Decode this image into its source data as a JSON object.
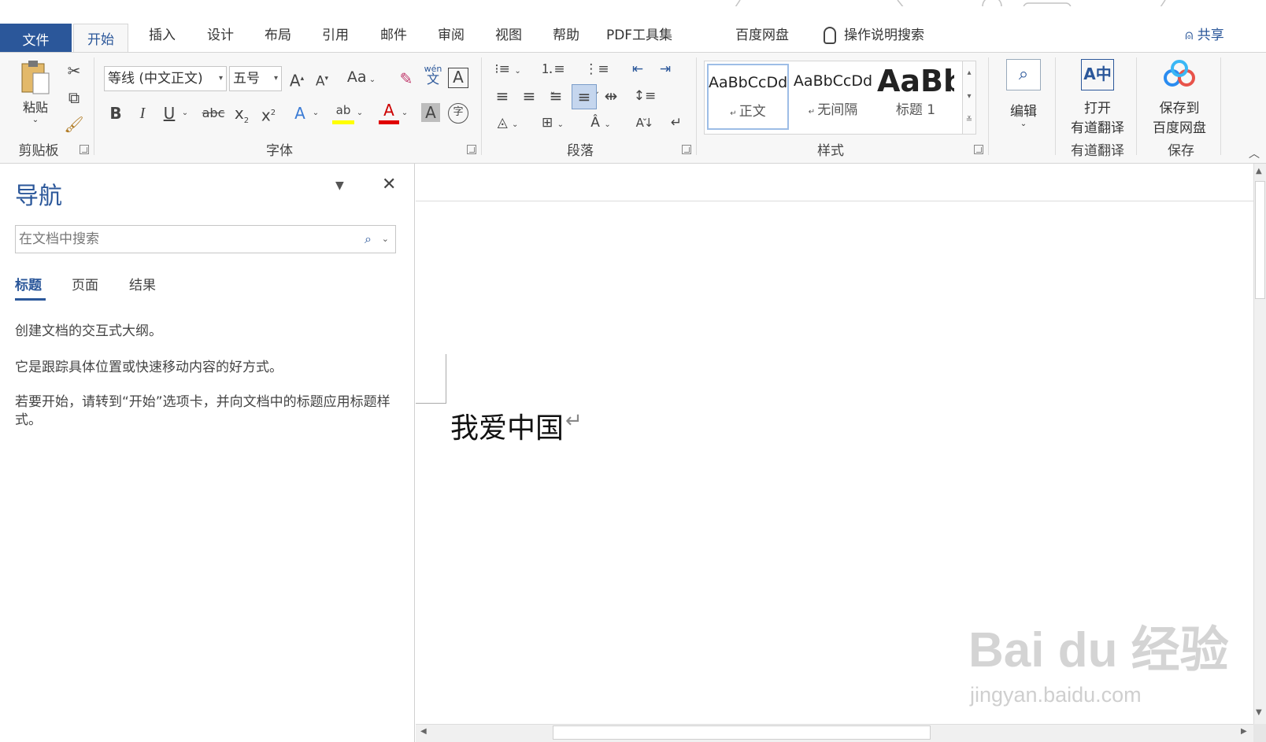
{
  "tabs": [
    {
      "label": "文件"
    },
    {
      "label": "开始"
    },
    {
      "label": "插入"
    },
    {
      "label": "设计"
    },
    {
      "label": "布局"
    },
    {
      "label": "引用"
    },
    {
      "label": "邮件"
    },
    {
      "label": "审阅"
    },
    {
      "label": "视图"
    },
    {
      "label": "帮助"
    },
    {
      "label": "PDF工具集"
    },
    {
      "label": "百度网盘"
    }
  ],
  "tell_me": "操作说明搜索",
  "share": "共享",
  "ribbon": {
    "clipboard": {
      "paste": "粘贴",
      "label": "剪贴板"
    },
    "font": {
      "name": "等线 (中文正文)",
      "size": "五号",
      "change_case": "Aa",
      "phonetic": "wén",
      "phonetic_char": "文",
      "label": "字体"
    },
    "paragraph": {
      "label": "段落"
    },
    "styles": {
      "label": "样式",
      "items": [
        {
          "sample": "AaBbCcDd",
          "name": "正文"
        },
        {
          "sample": "AaBbCcDd",
          "name": "无间隔"
        },
        {
          "sample": "AaBb",
          "name": "标题 1"
        }
      ]
    },
    "editing": {
      "label": "编辑"
    },
    "youdao": {
      "line1": "打开",
      "line2": "有道翻译",
      "label": "有道翻译"
    },
    "baidu": {
      "line1": "保存到",
      "line2": "百度网盘",
      "label": "保存"
    }
  },
  "nav": {
    "title": "导航",
    "search_placeholder": "在文档中搜索",
    "tabs": [
      {
        "label": "标题"
      },
      {
        "label": "页面"
      },
      {
        "label": "结果"
      }
    ],
    "help1": "创建文档的交互式大纲。",
    "help2": "它是跟踪具体位置或快速移动内容的好方式。",
    "help3": "若要开始，请转到“开始”选项卡，并向文档中的标题应用标题样式。"
  },
  "document": {
    "text": "我爱中国",
    "para_mark": "↵"
  },
  "watermark": {
    "brand": "Bai du 经验",
    "url": "jingyan.baidu.com"
  },
  "colors": {
    "accent": "#2b579a",
    "highlight": "#ffff00",
    "font_color": "#ff0000"
  }
}
